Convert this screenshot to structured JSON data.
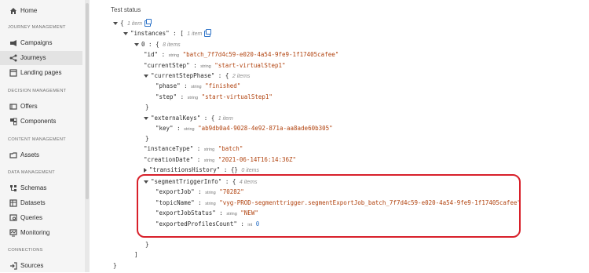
{
  "sidebar": {
    "home": "Home",
    "sections": {
      "journey_mgmt": "JOURNEY MANAGEMENT",
      "decision_mgmt": "DECISION MANAGEMENT",
      "content_mgmt": "CONTENT MANAGEMENT",
      "data_mgmt": "DATA MANAGEMENT",
      "connections": "CONNECTIONS"
    },
    "items": {
      "campaigns": "Campaigns",
      "journeys": "Journeys",
      "landing_pages": "Landing pages",
      "offers": "Offers",
      "components": "Components",
      "assets": "Assets",
      "schemas": "Schemas",
      "datasets": "Datasets",
      "queries": "Queries",
      "monitoring": "Monitoring",
      "sources": "Sources"
    },
    "active": "Journeys"
  },
  "main": {
    "section_title": "Test status",
    "json": {
      "open_brace": "{",
      "root_count": "1 item",
      "instances_key": "\"instances\"",
      "array_open": "[",
      "instances_count": "1 item",
      "index0": "0",
      "obj_open": "{",
      "index0_count": "8 items",
      "id_key": "\"id\"",
      "id_type": "string",
      "id_value": "\"batch_7f7d4c59-e020-4a54-9fe9-1f17405cafee\"",
      "currentStep_key": "\"currentStep\"",
      "currentStep_type": "string",
      "currentStep_value": "\"start-virtualStep1\"",
      "currentStepPhase_key": "\"currentStepPhase\"",
      "currentStepPhase_count": "2 items",
      "phase_key": "\"phase\"",
      "phase_type": "string",
      "phase_value": "\"finished\"",
      "step_key": "\"step\"",
      "step_type": "string",
      "step_value": "\"start-virtualStep1\"",
      "close_brace": "}",
      "externalKeys_key": "\"externalKeys\"",
      "externalKeys_count": "1 item",
      "key_key": "\"key\"",
      "key_type": "string",
      "key_value": "\"ab9db0a4-9028-4e92-871a-aa8ade60b305\"",
      "instanceType_key": "\"instanceType\"",
      "instanceType_type": "string",
      "instanceType_value": "\"batch\"",
      "creationDate_key": "\"creationDate\"",
      "creationDate_type": "string",
      "creationDate_value": "\"2021-06-14T16:14:36Z\"",
      "transitionsHistory_key": "\"transitionsHistory\"",
      "transitionsHistory_brace": "{}",
      "transitionsHistory_count": "0 items",
      "segmentTriggerInfo_key": "\"segmentTriggerInfo\"",
      "segmentTriggerInfo_count": "4 items",
      "exportJob_key": "\"exportJob\"",
      "exportJob_type": "string",
      "exportJob_value": "\"70282\"",
      "topicName_key": "\"topicName\"",
      "topicName_type": "string",
      "topicName_value": "\"vyg-PROD-segmenttrigger.segmentExportJob_batch_7f7d4c59-e020-4a54-9fe9-1f17405cafee\"",
      "exportJobStatus_key": "\"exportJobStatus\"",
      "exportJobStatus_type": "string",
      "exportJobStatus_value": "\"NEW\"",
      "exportedProfilesCount_key": "\"exportedProfilesCount\"",
      "exportedProfilesCount_type": "int",
      "exportedProfilesCount_value": "0",
      "array_close": "]"
    }
  }
}
